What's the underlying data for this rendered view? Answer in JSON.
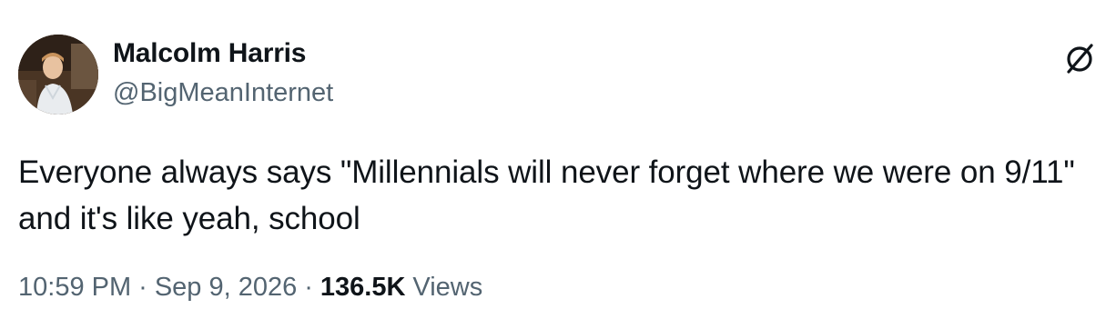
{
  "author": {
    "display_name": "Malcolm Harris",
    "handle": "@BigMeanInternet"
  },
  "tweet": {
    "text": "Everyone always says \"Millennials will never forget where we were on 9/11\" and it's like yeah, school"
  },
  "meta": {
    "time": "10:59 PM",
    "separator": "·",
    "date": "Sep 9, 2026",
    "views_count": "136.5K",
    "views_label": "Views"
  },
  "icons": {
    "menu": "grok-slash-icon",
    "avatar": "profile-photo"
  },
  "colors": {
    "text_primary": "#0f1419",
    "text_secondary": "#536471",
    "background": "#ffffff"
  }
}
